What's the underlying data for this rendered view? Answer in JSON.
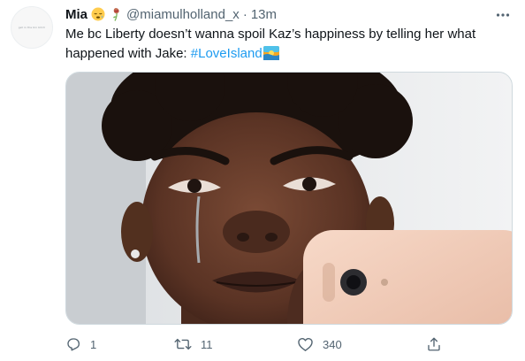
{
  "user": {
    "display_name": "Mia",
    "handle": "@miamulholland_x",
    "separator": "·",
    "time": "13m",
    "avatar_text": "get in the bin bitch"
  },
  "tweet": {
    "text_before": "Me bc Liberty doesn’t wanna spoil Kaz’s happiness by telling her what happened with Jake: ",
    "hashtag": "#LoveIsland"
  },
  "icons": {
    "name_emojis": [
      "sleepy-face-emoji",
      "wilted-rose-emoji"
    ],
    "hashtag_emoji": "love-island-hashflag-emoji",
    "more": "more-icon",
    "reply": "reply-icon",
    "retweet": "retweet-icon",
    "like": "heart-icon",
    "share": "share-icon"
  },
  "actions": {
    "replies": "1",
    "retweets": "11",
    "likes": "340"
  },
  "colors": {
    "link": "#1d9bf0",
    "secondary": "#536471",
    "primary_text": "#0f1419"
  }
}
